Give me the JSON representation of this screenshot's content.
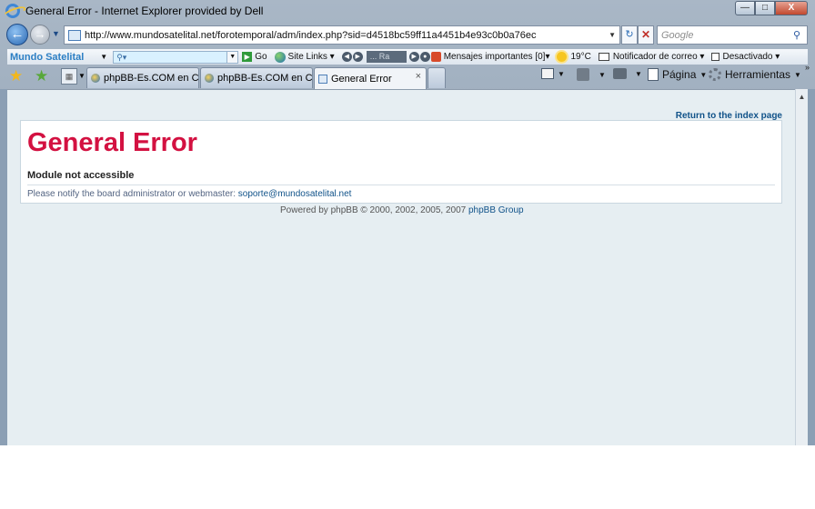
{
  "window": {
    "title": "General Error - Internet Explorer provided by Dell",
    "minimize": "—",
    "maximize": "□",
    "close": "X"
  },
  "navbar": {
    "url": "http://www.mundosatelital.net/forotemporal/adm/index.php?sid=d4518bc59ff11a4451b4e93c0b0a76ec",
    "search_placeholder": "Google"
  },
  "toolbar": {
    "brand": "Mundo Satelital",
    "go_label": "Go",
    "site_links_label": "Site Links",
    "radio_label": "... Ra",
    "messages_label": "Mensajes importantes",
    "messages_count": "[0]",
    "weather_label": "19°C",
    "mail_notifier_label": "Notificador de correo",
    "disabled_label": "Desactivado"
  },
  "tabs": [
    {
      "label": "phpBB-Es.COM en Ca...",
      "active": false
    },
    {
      "label": "phpBB-Es.COM en Ca...",
      "active": false
    },
    {
      "label": "General Error",
      "active": true
    }
  ],
  "commands": {
    "page_label": "Página",
    "tools_label": "Herramientas"
  },
  "page": {
    "return_link": "Return to the index page",
    "error_title": "General Error",
    "error_subtitle": "Module not accessible",
    "notify_text": "Please notify the board administrator or webmaster: ",
    "notify_email": "soporte@mundosatelital.net",
    "powered_text": "Powered by phpBB © 2000, 2002, 2005, 2007 ",
    "powered_link": "phpBB Group"
  },
  "colors": {
    "error_title": "#d31141",
    "link": "#105289",
    "content_bg": "#e6eef2"
  }
}
